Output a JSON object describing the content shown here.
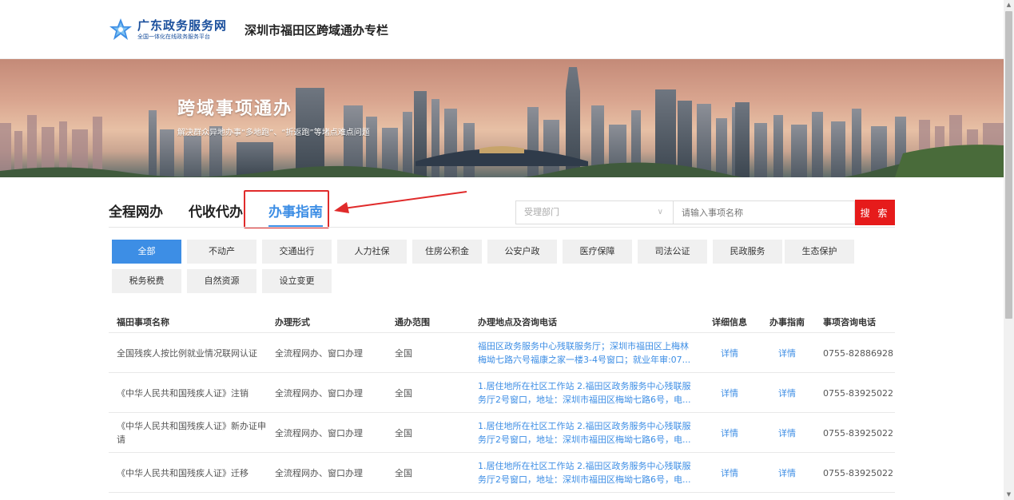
{
  "header": {
    "logo_title": "广东政务服务网",
    "logo_subtitle": "全国一体化在线政务服务平台",
    "site_title": "深圳市福田区跨域通办专栏"
  },
  "banner": {
    "title": "跨域事项通办",
    "subtitle": "解决群众异地办事“多地跑”、“折返跑”等堵点难点问题"
  },
  "tabs": [
    {
      "label": "全程网办",
      "active": false
    },
    {
      "label": "代收代办",
      "active": false
    },
    {
      "label": "办事指南",
      "active": true
    }
  ],
  "search": {
    "dept_placeholder": "受理部门",
    "input_placeholder": "请输入事项名称",
    "button_label": "搜 索"
  },
  "categories": [
    "全部",
    "不动产",
    "交通出行",
    "人力社保",
    "住房公积金",
    "公安户政",
    "医疗保障",
    "司法公证",
    "民政服务",
    "生态保护",
    "税务税费",
    "自然资源",
    "设立变更"
  ],
  "table": {
    "headers": [
      "福田事项名称",
      "办理形式",
      "通办范围",
      "办理地点及咨询电话",
      "详细信息",
      "办事指南",
      "事项咨询电话"
    ],
    "rows": [
      {
        "name": "全国残疾人按比例就业情况联网认证",
        "form": "全流程网办、窗口办理",
        "scope": "全国",
        "address": "福田区政务服务中心残联服务厅；深圳市福田区上梅林梅坳七路六号福康之家一楼3-4号窗口；就业年审:07...",
        "detail": "详情",
        "guide": "详情",
        "phone": "0755-82886928"
      },
      {
        "name": "《中华人民共和国残疾人证》注销",
        "form": "全流程网办、窗口办理",
        "scope": "全国",
        "address": "1.居住地所在社区工作站 2.福田区政务服务中心残联服务厅2号窗口，地址：深圳市福田区梅坳七路6号，电...",
        "detail": "详情",
        "guide": "详情",
        "phone": "0755-83925022"
      },
      {
        "name": "《中华人民共和国残疾人证》新办证申请",
        "form": "全流程网办、窗口办理",
        "scope": "全国",
        "address": "1.居住地所在社区工作站 2.福田区政务服务中心残联服务厅2号窗口，地址：深圳市福田区梅坳七路6号，电...",
        "detail": "详情",
        "guide": "详情",
        "phone": "0755-83925022"
      },
      {
        "name": "《中华人民共和国残疾人证》迁移",
        "form": "全流程网办、窗口办理",
        "scope": "全国",
        "address": "1.居住地所在社区工作站 2.福田区政务服务中心残联服务厅2号窗口，地址：深圳市福田区梅坳七路6号，电...",
        "detail": "详情",
        "guide": "详情",
        "phone": "0755-83925022"
      }
    ]
  },
  "colors": {
    "accent": "#3d8ee5",
    "search_button": "#e61b1b",
    "highlight": "#e02b2b",
    "logo": "#1a4f9c"
  },
  "icons": {
    "logo": "star-flower-logo-icon",
    "dropdown": "chevron-down-icon",
    "annotation": "red-arrow-icon"
  }
}
